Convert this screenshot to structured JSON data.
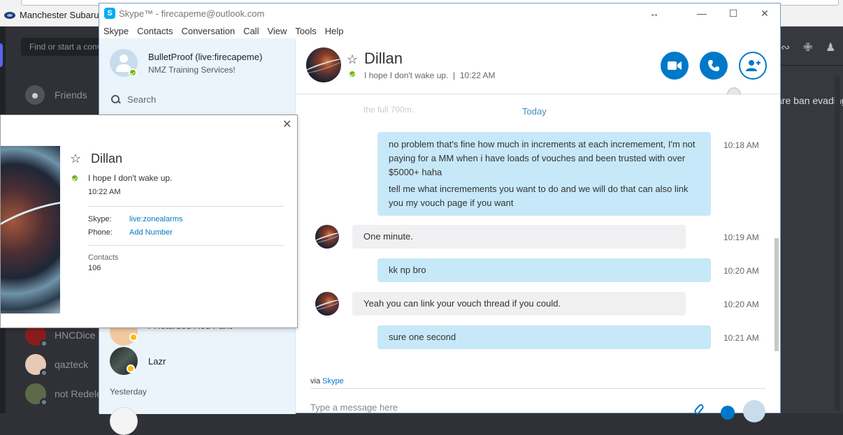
{
  "browser": {
    "bookmark": "Manchester Subaru"
  },
  "discord": {
    "find_placeholder": "Find or start a conversation",
    "friends_label": "Friends",
    "dms": [
      {
        "name": "HNCDice"
      },
      {
        "name": "qazteck"
      },
      {
        "name": "not Redeless"
      }
    ],
    "right_text": "are ban evading"
  },
  "skype": {
    "title": "Skype™ - firecapeme@outlook.com",
    "menu": [
      "Skype",
      "Contacts",
      "Conversation",
      "Call",
      "View",
      "Tools",
      "Help"
    ],
    "me": {
      "name": "BulletProof (live:firecapeme)",
      "mood": "NMZ Training Services!"
    },
    "search_label": "Search",
    "sidebar": {
      "partial_contact": "r Retarded Red Panda",
      "contact_lazr": "Lazr",
      "yesterday": "Yesterday"
    },
    "conversation": {
      "name": "Dillan",
      "status": "I hope I don't wake up.",
      "status_time": "10:22 AM",
      "faded_text": "the full 700m.",
      "today": "Today",
      "messages": [
        {
          "from": "me",
          "lines": [
            "no problem that's fine how much in increments at each incremement, I'm not paying for a MM when i have loads of vouches and been trusted with over $5000+ haha",
            "tell me what incremements you want to do and we will do that can also link you my vouch page if you want"
          ],
          "time": "10:18 AM"
        },
        {
          "from": "them",
          "lines": [
            "One minute."
          ],
          "time": "10:19 AM"
        },
        {
          "from": "me",
          "lines": [
            "kk np bro"
          ],
          "time": "10:20 AM"
        },
        {
          "from": "them",
          "lines": [
            "Yeah you can link your vouch thread if you could."
          ],
          "time": "10:20 AM"
        },
        {
          "from": "me",
          "lines": [
            "sure one second"
          ],
          "time": "10:21 AM"
        }
      ],
      "via_prefix": "via",
      "via_link": "Skype",
      "composer_placeholder": "Type a message here"
    },
    "profile_popup": {
      "name": "Dillan",
      "mood": "I hope I don't wake up.",
      "time": "10:22 AM",
      "skype_label": "Skype:",
      "skype_value": "live:zonealarms",
      "phone_label": "Phone:",
      "phone_value": "Add Number",
      "contacts_label": "Contacts",
      "contacts_value": "106"
    }
  },
  "colors": {
    "skype_blue": "#0078ca",
    "my_bubble": "#c7e8f8",
    "their_bubble": "#f0f0f2",
    "sidebar_bg": "#ebf4fb",
    "online": "#6bb700",
    "away": "#ffb900"
  }
}
